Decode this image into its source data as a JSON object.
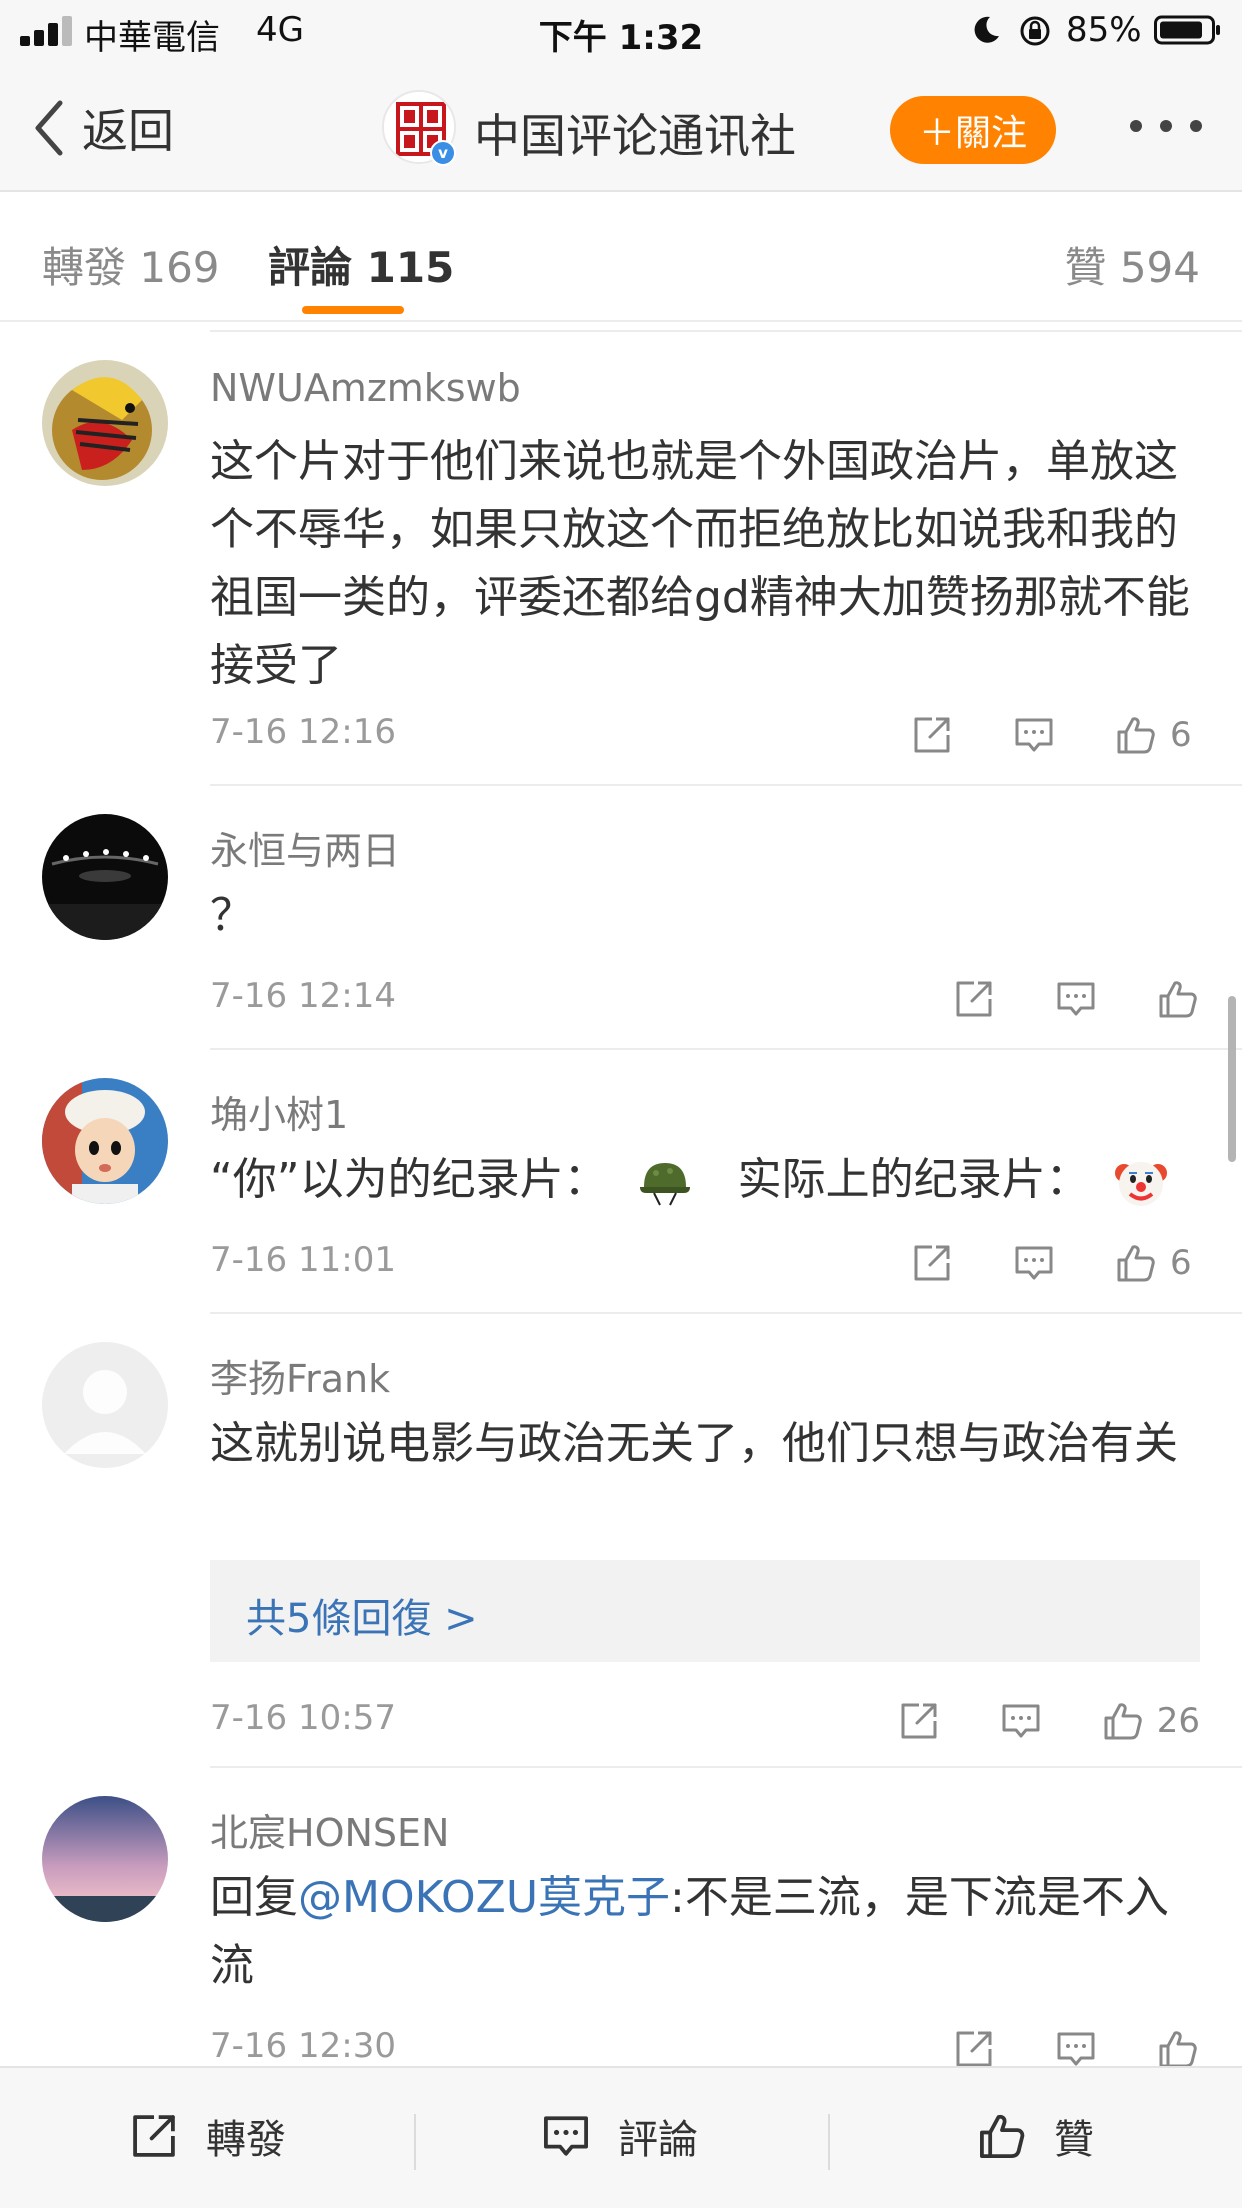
{
  "status_bar": {
    "carrier": "中華電信",
    "network": "4G",
    "time": "下午 1:32",
    "battery": "85%"
  },
  "nav": {
    "back_label": "返回",
    "title": "中国评论通讯社",
    "follow_label": "＋關注"
  },
  "tabs": [
    {
      "label": "轉發 169"
    },
    {
      "label": "評論 115"
    },
    {
      "label": "贊 594"
    }
  ],
  "comments": [
    {
      "user": "NWUAmzmkswb",
      "text": "这个片对于他们来说也就是个外国政治片，单放这个不辱华，如果只放这个而拒绝放比如说我和我的祖国一类的，评委还都给gd精神大加赞扬那就不能接受了",
      "time": "7-16 12:16",
      "likes": "6"
    },
    {
      "user": "永恒与两日",
      "text": "？",
      "time": "7-16 12:14",
      "likes": ""
    },
    {
      "user": "埆小树1",
      "text_part1": "“你”以为的纪录片：",
      "text_part2": "实际上的纪录片：",
      "emoji1": "military-helmet",
      "emoji2": "clown-face",
      "time": "7-16 11:01",
      "likes": "6"
    },
    {
      "user": "李扬Frank",
      "text": "这就别说电影与政治无关了，他们只想与政治有关",
      "replies_label": "共5條回復 >",
      "time": "7-16 10:57",
      "likes": "26"
    },
    {
      "user": "北宸HONSEN",
      "reply_prefix": "回复",
      "mention": "@MOKOZU莫克子",
      "text": ":不是三流，是下流是不入流",
      "time": "7-16 12:30",
      "likes": ""
    }
  ],
  "bottom_bar": {
    "repost_label": "轉發",
    "comment_label": "評論",
    "like_label": "贊"
  },
  "colors": {
    "accent": "#ff8200",
    "link": "#3b74b6",
    "background": "#f7f7f7"
  },
  "icons": [
    "back-chevron-icon",
    "more-icon",
    "share-icon",
    "comment-icon",
    "thumbs-up-icon"
  ]
}
